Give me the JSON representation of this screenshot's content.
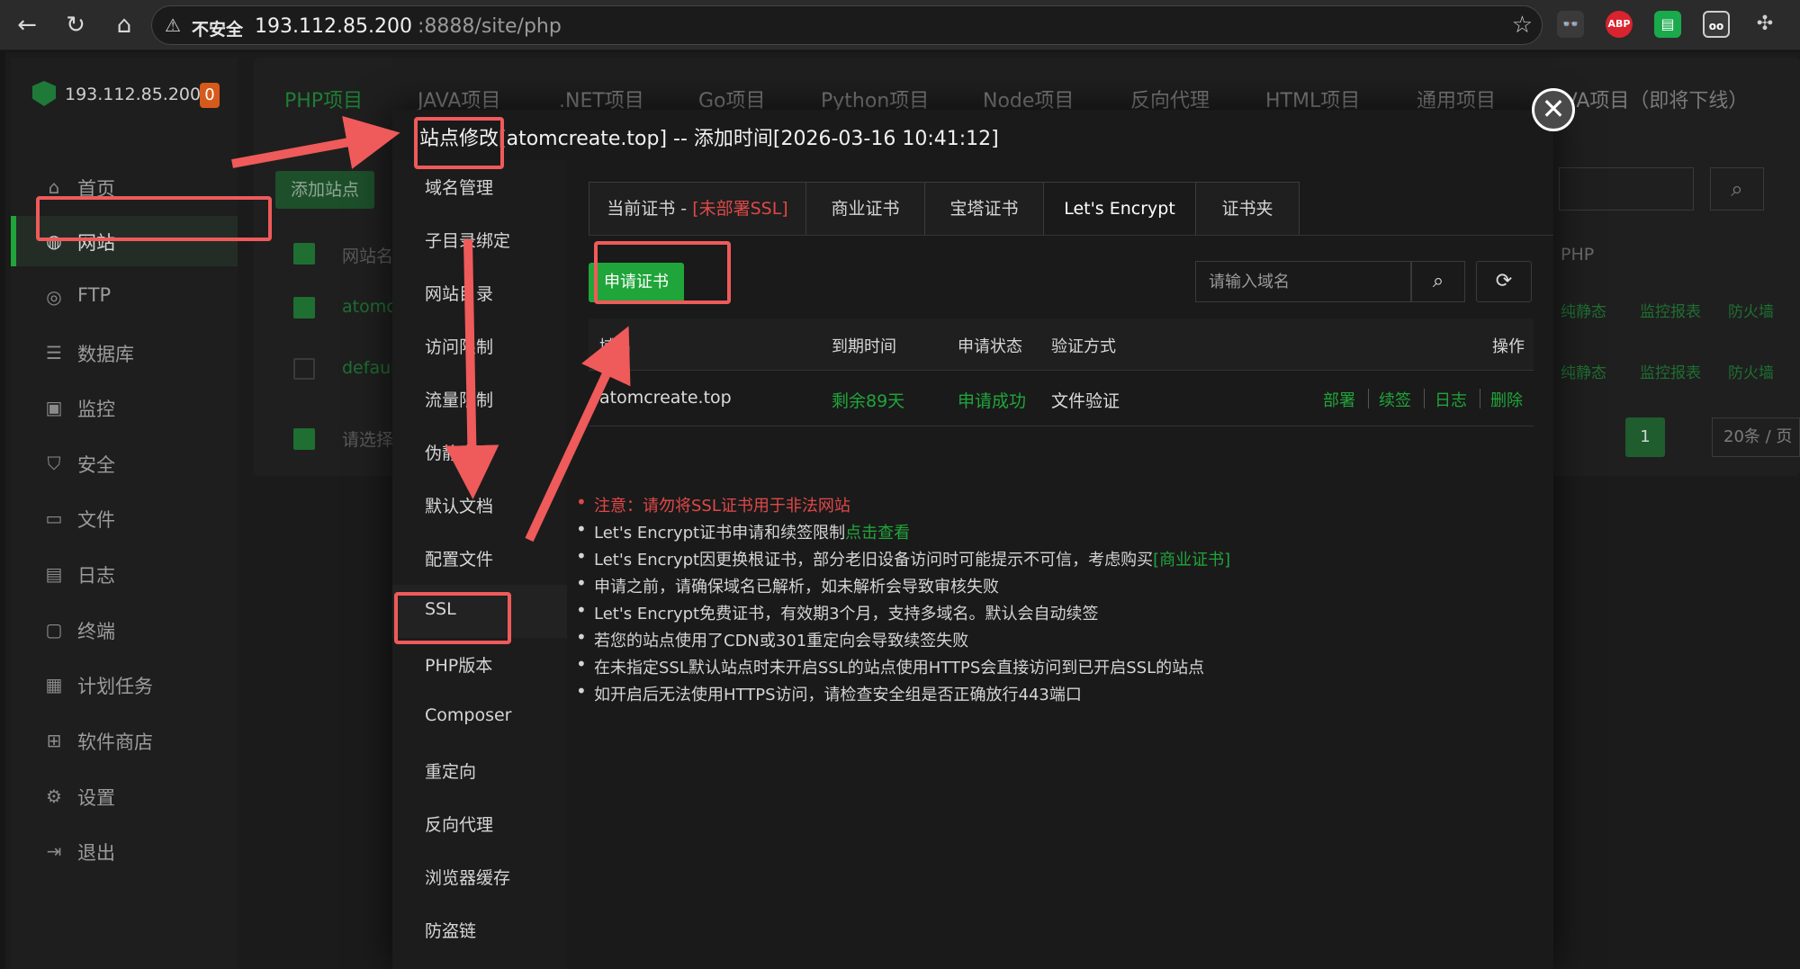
{
  "browser": {
    "insecure_label": "不安全",
    "url_host": "193.112.85.200",
    "url_path": ":8888/site/php",
    "extensions": [
      "glasses-ext",
      "ABP",
      "clipboard-ext",
      "reader-ext",
      "puzzle-ext"
    ]
  },
  "sidebar": {
    "server_ip": "193.112.85.200",
    "badge": "0",
    "items": [
      {
        "label": "首页",
        "icon": "home-icon"
      },
      {
        "label": "网站",
        "icon": "globe-icon"
      },
      {
        "label": "FTP",
        "icon": "ftp-icon"
      },
      {
        "label": "数据库",
        "icon": "database-icon"
      },
      {
        "label": "监控",
        "icon": "monitor-icon"
      },
      {
        "label": "安全",
        "icon": "shield-icon"
      },
      {
        "label": "文件",
        "icon": "folder-icon"
      },
      {
        "label": "日志",
        "icon": "log-icon"
      },
      {
        "label": "终端",
        "icon": "terminal-icon"
      },
      {
        "label": "计划任务",
        "icon": "calendar-icon"
      },
      {
        "label": "软件商店",
        "icon": "apps-icon"
      },
      {
        "label": "设置",
        "icon": "gear-icon"
      },
      {
        "label": "退出",
        "icon": "logout-icon"
      }
    ]
  },
  "top_tabs": [
    "PHP项目",
    "JAVA项目",
    ".NET项目",
    "Go项目",
    "Python项目",
    "Node项目",
    "反向代理",
    "HTML项目",
    "通用项目",
    "JAVA项目（即将下线）"
  ],
  "background": {
    "add_site": "添加站点",
    "col_site": "网站名",
    "row1": "atomc",
    "row2": "defaul",
    "select_placeholder": "请选择",
    "col_php": "PHP",
    "row1_ops": [
      "纯静态",
      "监控报表",
      "防火墙"
    ],
    "row2_ops": [
      "纯静态",
      "监控报表",
      "防火墙"
    ],
    "page": "1",
    "page_size": "20条 / 页"
  },
  "modal": {
    "title": "站点修改[atomcreate.top] -- 添加时间[2026-03-16 10:41:12]",
    "nav": [
      "域名管理",
      "子目录绑定",
      "网站目录",
      "访问限制",
      "流量限制",
      "伪静态",
      "默认文档",
      "配置文件",
      "SSL",
      "PHP版本",
      "Composer",
      "重定向",
      "反向代理",
      "浏览器缓存",
      "防盗链"
    ],
    "ssl_tabs": {
      "current_prefix": "当前证书 - ",
      "current_status": "[未部署SSL]",
      "commercial": "商业证书",
      "baota": "宝塔证书",
      "letsencrypt": "Let's Encrypt",
      "folder": "证书夹"
    },
    "apply_button": "申请证书",
    "search_placeholder": "请输入域名",
    "table": {
      "headers": {
        "domain": "域名",
        "expire": "到期时间",
        "status": "申请状态",
        "verify": "验证方式",
        "ops": "操作"
      },
      "row": {
        "domain": "atomcreate.top",
        "expire": "剩余89天",
        "status": "申请成功",
        "verify": "文件验证"
      },
      "ops": [
        "部署",
        "续签",
        "日志",
        "删除"
      ]
    },
    "notes": {
      "n1": "注意：请勿将SSL证书用于非法网站",
      "n2_text": "Let's Encrypt证书申请和续签限制",
      "n2_link": "点击查看",
      "n3_text": "Let's Encrypt因更换根证书，部分老旧设备访问时可能提示不可信，考虑购买",
      "n3_link": "[商业证书]",
      "n4": "申请之前，请确保域名已解析，如未解析会导致审核失败",
      "n5": "Let's Encrypt免费证书，有效期3个月，支持多域名。默认会自动续签",
      "n6": "若您的站点使用了CDN或301重定向会导致续签失败",
      "n7": "在未指定SSL默认站点时未开启SSL的站点使用HTTPS会直接访问到已开启SSL的站点",
      "n8": "如开启后无法使用HTTPS访问，请检查安全组是否正确放行443端口"
    }
  },
  "colors": {
    "accent": "#20a53a",
    "warning": "#e04848",
    "annotation": "#ef5a5a"
  }
}
